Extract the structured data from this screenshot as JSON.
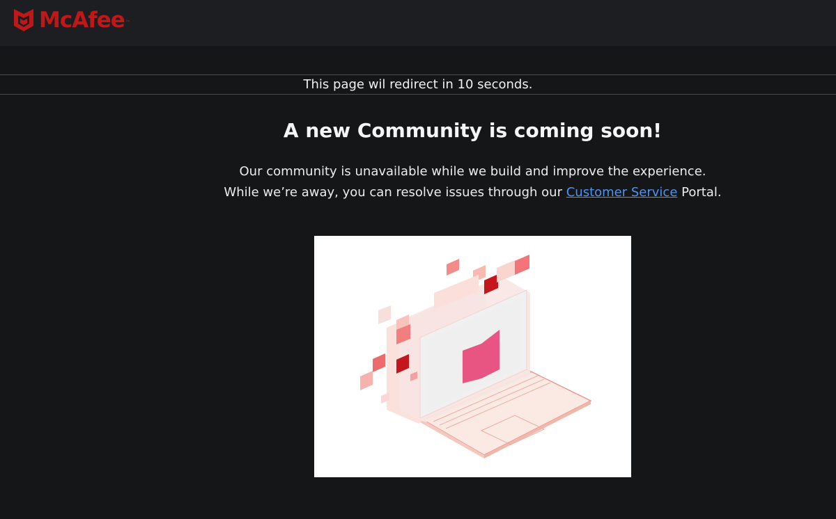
{
  "header": {
    "logo_text": "McAfee",
    "logo_tm": "™"
  },
  "redirect": {
    "text": "This page wil redirect in 10 seconds."
  },
  "main": {
    "title": "A new Community is coming soon!",
    "line1": "Our community is unavailable while we build and improve the experience.",
    "line2_before": "While we’re away, you can resolve issues through our ",
    "link_text": "Customer Service",
    "line2_after": " Portal."
  },
  "colors": {
    "brand_red": "#c01818",
    "link_blue": "#4f93f2",
    "background": "#151618",
    "header_bg": "#1d1e21"
  },
  "icons": {
    "logo": "mcafee-shield-icon",
    "illustration": "laptop-security-illustration"
  }
}
